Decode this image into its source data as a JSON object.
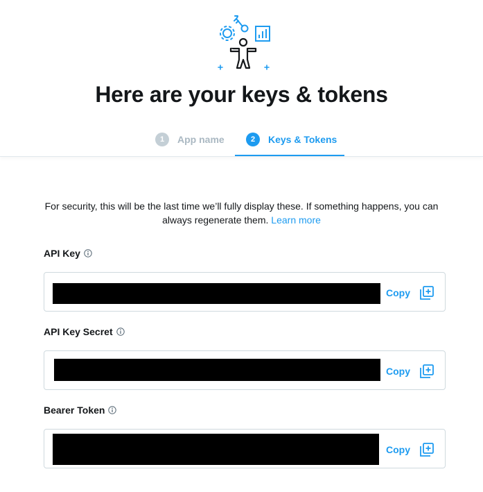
{
  "header": {
    "title": "Here are your keys & tokens",
    "illustration_icon": "developer-keys-illustration"
  },
  "stepper": {
    "steps": [
      {
        "number": "1",
        "label": "App name",
        "state": "inactive"
      },
      {
        "number": "2",
        "label": "Keys & Tokens",
        "state": "active"
      }
    ]
  },
  "notice": {
    "text": "For security, this will be the last time we’ll fully display these. If something happens, you can always regenerate them.",
    "link_label": "Learn more"
  },
  "fields": [
    {
      "label": "API Key",
      "value": "[redacted]",
      "copy_label": "Copy"
    },
    {
      "label": "API Key Secret",
      "value": "[redacted]",
      "copy_label": "Copy"
    },
    {
      "label": "Bearer Token",
      "value": "[redacted]",
      "copy_label": "Copy"
    }
  ],
  "colors": {
    "accent": "#1d9bf0",
    "text": "#14171a",
    "muted": "#aab8c2",
    "border": "#cfd9de"
  }
}
